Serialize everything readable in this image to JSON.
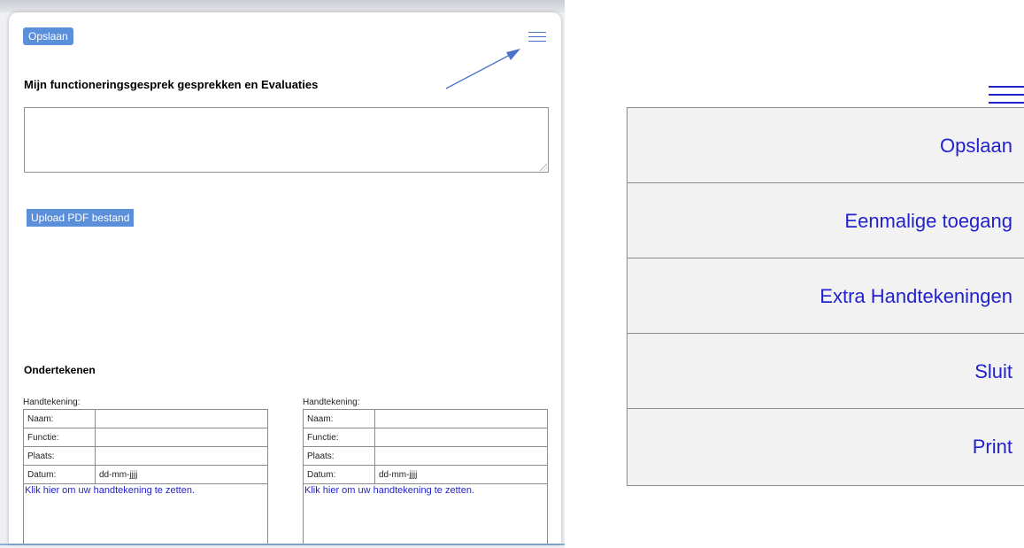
{
  "modal": {
    "save_label": "Opslaan",
    "title": "Mijn functioneringsgesprek gesprekken en Evaluaties",
    "textarea_value": "",
    "upload_label": "Upload PDF bestand",
    "sign_title": "Ondertekenen",
    "signatures": [
      {
        "label": "Handtekening:",
        "rows": [
          {
            "key": "Naam:",
            "value": ""
          },
          {
            "key": "Functie:",
            "value": ""
          },
          {
            "key": "Plaats:",
            "value": ""
          },
          {
            "key": "Datum:",
            "value": "dd-mm-jjjj"
          }
        ],
        "click_text": "Klik hier om uw handtekening te zetten."
      },
      {
        "label": "Handtekening:",
        "rows": [
          {
            "key": "Naam:",
            "value": ""
          },
          {
            "key": "Functie:",
            "value": ""
          },
          {
            "key": "Plaats:",
            "value": ""
          },
          {
            "key": "Datum:",
            "value": "dd-mm-jjjj"
          }
        ],
        "click_text": "Klik hier om uw handtekening te zetten."
      }
    ]
  },
  "menu": {
    "items": [
      {
        "label": "Opslaan"
      },
      {
        "label": "Eenmalige toegang"
      },
      {
        "label": "Extra Handtekeningen"
      },
      {
        "label": "Sluit"
      },
      {
        "label": "Print"
      }
    ]
  },
  "colors": {
    "button_bg": "#5b8fd9",
    "link_blue": "#2222cc",
    "menu_bg": "#f2f2f2",
    "arrow": "#4a73c9"
  },
  "icons": {
    "menu": "hamburger-icon",
    "pointer": "arrow-annotation"
  }
}
